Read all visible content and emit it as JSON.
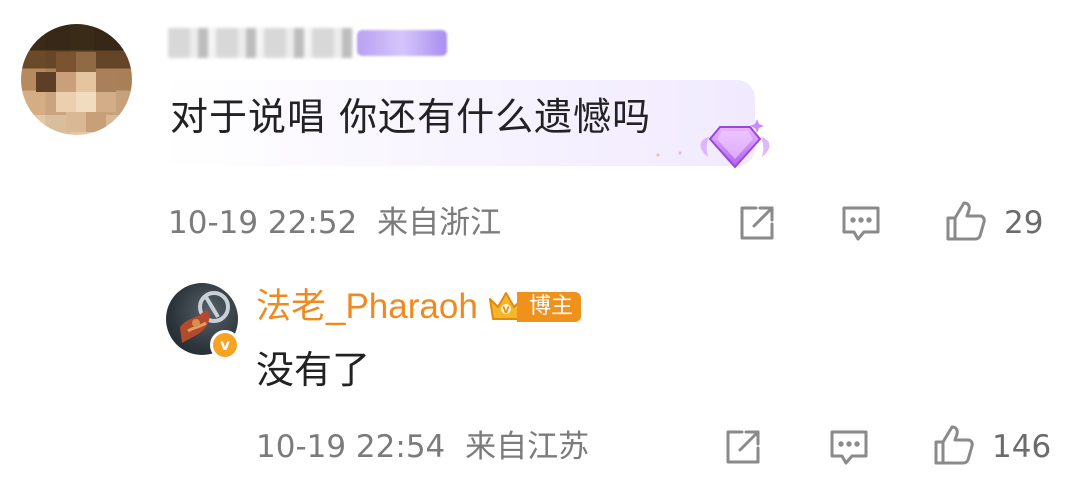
{
  "comment": {
    "avatar": "blurred-user-avatar",
    "username": "",
    "text": "对于说唱 你还有什么遗憾吗",
    "timestamp": "10-19 22:52",
    "location": "来自浙江",
    "like_count": "29"
  },
  "reply": {
    "avatar": "pharaoh-avatar",
    "username": "法老_Pharaoh",
    "badge_label": "博主",
    "verified_mark": "v",
    "text": "没有了",
    "timestamp": "10-19 22:54",
    "location": "来自江苏",
    "like_count": "146"
  },
  "icons": {
    "share": "share-icon",
    "comment": "comment-icon",
    "like": "like-icon"
  },
  "colors": {
    "author_name": "#f08a1f",
    "badge_bg": "#f0911c",
    "verified": "#f6a324",
    "meta_text": "#7b7b7b",
    "bubble_tint": "#f1eaff"
  }
}
